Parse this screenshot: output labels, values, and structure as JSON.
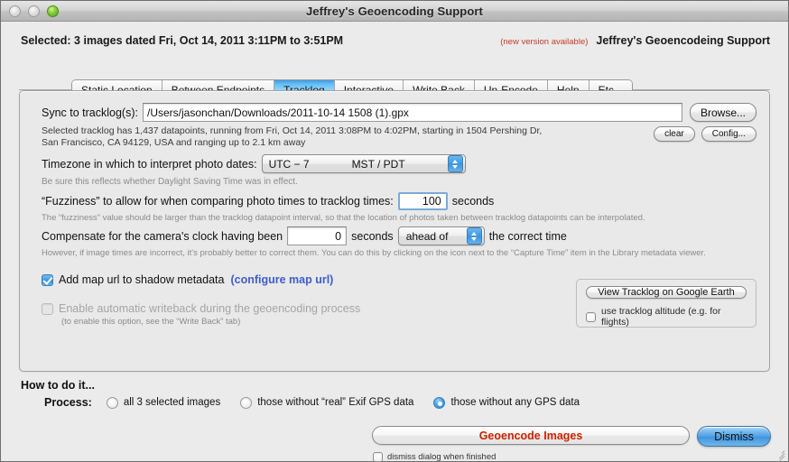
{
  "window": {
    "title": "Jeffrey's Geoencoding Support",
    "traffic_lights": [
      "close-gray",
      "minimize-gray",
      "zoom-green"
    ]
  },
  "header": {
    "selected_text": "Selected: 3 images dated Fri, Oct 14, 2011 3:11PM to 3:51PM",
    "new_version_label": "(new version available)",
    "brand_name": "Jeffrey's Geoencodeing Support"
  },
  "tabs": [
    {
      "label": "Static Location",
      "active": false
    },
    {
      "label": "Between Endpoints",
      "active": false
    },
    {
      "label": "Tracklog",
      "active": true
    },
    {
      "label": "Interactive",
      "active": false
    },
    {
      "label": "Write Back",
      "active": false
    },
    {
      "label": "Un-Encode",
      "active": false
    },
    {
      "label": "Help",
      "active": false
    },
    {
      "label": "Etc...",
      "active": false
    }
  ],
  "tracklog": {
    "sync_label": "Sync to tracklog(s):",
    "sync_value": "/Users/jasonchan/Downloads/2011-10-14 1508 (1).gpx",
    "browse_label": "Browse...",
    "description": "Selected tracklog has 1,437 datapoints, running from Fri, Oct 14, 2011 3:08PM to 4:02PM, starting in 1504 Pershing Dr, San Francisco, CA 94129, USA and ranging up to 2.1 km away",
    "clear_label": "clear",
    "config_label": "Config...",
    "timezone_label": "Timezone in which to interpret photo dates:",
    "timezone_offset": "UTC −  7",
    "timezone_name": "MST / PDT",
    "timezone_hint": "Be sure this reflects whether Daylight Saving Time was in effect.",
    "fuzziness_label": "“Fuzziness” to allow for when comparing photo times to tracklog times:",
    "fuzziness_value": "100",
    "fuzziness_units": "seconds",
    "fuzziness_hint": "The “fuzziness” value should be larger than the tracklog datapoint interval, so that the location of photos taken between tracklog datapoints can be interpolated.",
    "compensate_label": "Compensate for the camera's clock having been",
    "compensate_value": "0",
    "compensate_units": "seconds",
    "compensate_direction": "ahead of",
    "compensate_suffix": "the correct time",
    "compensate_hint": "However, if image times are incorrect, it's probably better to correct them. You can do this by clicking on the icon next to the “Capture Time” item in the Library metadata viewer.",
    "add_map_url_label": "Add map url to shadow metadata",
    "add_map_url_checked": true,
    "configure_map_url_link": "(configure map url)",
    "auto_writeback_label": "Enable automatic writeback during the geoencoding process",
    "auto_writeback_checked": false,
    "auto_writeback_hint": "(to enable this option, see the “Write Back” tab)",
    "google_earth_button": "View Tracklog on Google Earth",
    "use_altitude_label": "use tracklog altitude (e.g. for flights)",
    "use_altitude_checked": false
  },
  "bottom": {
    "howto_label": "How to do it...",
    "process_label": "Process:",
    "process_options": [
      {
        "label": "all 3 selected images",
        "selected": false
      },
      {
        "label": "those without “real” Exif GPS data",
        "selected": false
      },
      {
        "label": "those without any GPS data",
        "selected": true
      }
    ],
    "geoencode_button": "Geoencode Images",
    "dismiss_button": "Dismiss",
    "dismiss_when_finished_label": "dismiss dialog when finished",
    "dismiss_when_finished_checked": false
  },
  "colors": {
    "accent_blue": "#3e9be3",
    "alert_red": "#c13b2c",
    "action_red": "#cc2200",
    "link_blue": "#3e5ccd",
    "window_bg": "#ebebeb"
  }
}
